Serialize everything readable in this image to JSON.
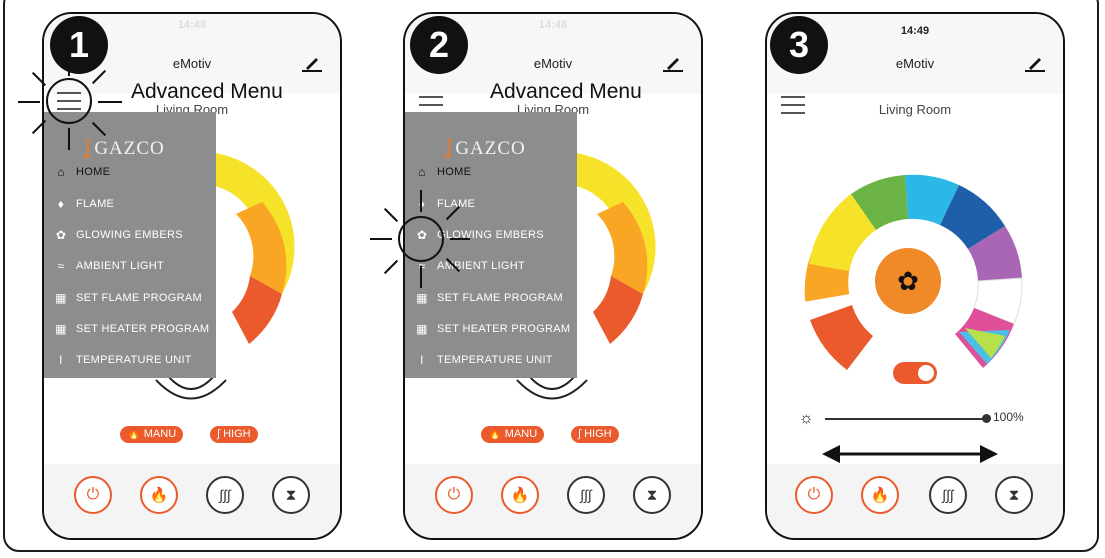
{
  "app": {
    "title": "eMotiv",
    "room": "Living Room"
  },
  "annotation": {
    "label": "Advanced Menu"
  },
  "steps": [
    "1",
    "2",
    "3"
  ],
  "status": {
    "time_p1": "14:48",
    "time_p2": "14:48",
    "time_p3": "14:49"
  },
  "menu": {
    "logo": "GAZCO",
    "items": [
      {
        "label": "HOME",
        "icon": "home-icon"
      },
      {
        "label": "FLAME",
        "icon": "flame-icon"
      },
      {
        "label": "GLOWING EMBERS",
        "icon": "embers-icon"
      },
      {
        "label": "AMBIENT LIGHT",
        "icon": "ambient-light-icon"
      },
      {
        "label": "SET FLAME PROGRAM",
        "icon": "calendar-icon"
      },
      {
        "label": "SET HEATER PROGRAM",
        "icon": "calendar-icon"
      },
      {
        "label": "TEMPERATURE UNIT",
        "icon": "thermometer-icon"
      }
    ]
  },
  "modes": {
    "manu": "MANU",
    "high": "HIGH"
  },
  "bottom_nav": [
    "power-icon",
    "flame-icon",
    "heat-icon",
    "timer-icon"
  ],
  "brightness": {
    "value_label": "100%",
    "value": 1.0
  },
  "ambient": {
    "toggle_on": true
  },
  "colors": {
    "accent": "#ea5a2c",
    "menu_bg": "#8c8d8f"
  }
}
